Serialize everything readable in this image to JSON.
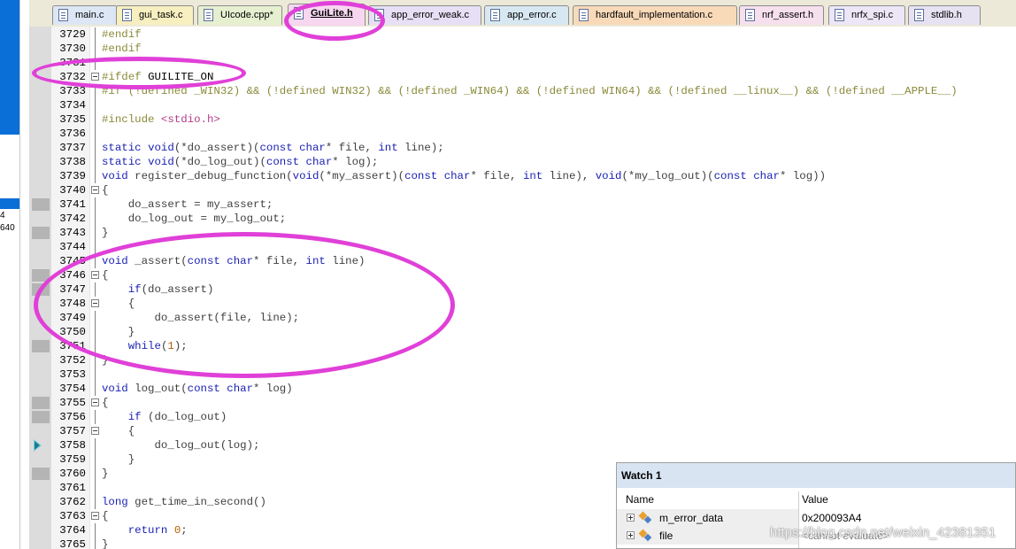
{
  "left_pane": {
    "fragments": [
      "4",
      "640"
    ]
  },
  "tabs": [
    {
      "label": "main.c",
      "active": false,
      "color": "#dce6f4"
    },
    {
      "label": "gui_task.c",
      "active": false,
      "color": "#f7efc0"
    },
    {
      "label": "UIcode.cpp*",
      "active": false,
      "color": "#e6efd0"
    },
    {
      "label": "GuiLite.h",
      "active": true,
      "color": "#f7d6f0"
    },
    {
      "label": "app_error_weak.c",
      "active": false,
      "color": "#e6dff5"
    },
    {
      "label": "app_error.c",
      "active": false,
      "color": "#d8e8f2"
    },
    {
      "label": "hardfault_implementation.c",
      "active": false,
      "color": "#f8d9b8"
    },
    {
      "label": "nrf_assert.h",
      "active": false,
      "color": "#f7e0ee"
    },
    {
      "label": "nrfx_spi.c",
      "active": false,
      "color": "#ece6f7"
    },
    {
      "label": "stdlib.h",
      "active": false,
      "color": "#e6e2f2"
    }
  ],
  "code_lines": [
    {
      "num": "3729",
      "text": "#endif",
      "kind": "preproc",
      "fold": "line"
    },
    {
      "num": "3730",
      "text": "#endif",
      "kind": "preproc",
      "fold": "line"
    },
    {
      "num": "3731",
      "text": "",
      "kind": "plain",
      "fold": "line"
    },
    {
      "num": "3732",
      "text": "#ifdef GUILITE_ON",
      "kind": "ifdef",
      "fold": "box"
    },
    {
      "num": "3733",
      "text": "#if (!defined _WIN32) && (!defined WIN32) && (!defined _WIN64) && (!defined WIN64) && (!defined __linux__) && (!defined __APPLE__)",
      "kind": "preproc",
      "fold": "line"
    },
    {
      "num": "3734",
      "text": "",
      "kind": "plain",
      "fold": "line"
    },
    {
      "num": "3735",
      "text": "#include <stdio.h>",
      "kind": "preproc",
      "fold": "line"
    },
    {
      "num": "3736",
      "text": "",
      "kind": "plain",
      "fold": "line"
    },
    {
      "num": "3737",
      "text": "static void(*do_assert)(const char* file, int line);",
      "kind": "code",
      "fold": "line"
    },
    {
      "num": "3738",
      "text": "static void(*do_log_out)(const char* log);",
      "kind": "code",
      "fold": "line"
    },
    {
      "num": "3739",
      "text": "void register_debug_function(void(*my_assert)(const char* file, int line), void(*my_log_out)(const char* log))",
      "kind": "code",
      "fold": "line"
    },
    {
      "num": "3740",
      "text": "{",
      "kind": "code",
      "fold": "box"
    },
    {
      "num": "3741",
      "text": "    do_assert = my_assert;",
      "kind": "code",
      "fold": "line",
      "bp": true
    },
    {
      "num": "3742",
      "text": "    do_log_out = my_log_out;",
      "kind": "code",
      "fold": "line"
    },
    {
      "num": "3743",
      "text": "}",
      "kind": "code",
      "fold": "line",
      "bp": true
    },
    {
      "num": "3744",
      "text": "",
      "kind": "plain",
      "fold": "line"
    },
    {
      "num": "3745",
      "text": "void _assert(const char* file, int line)",
      "kind": "code",
      "fold": "line"
    },
    {
      "num": "3746",
      "text": "{",
      "kind": "code",
      "fold": "box",
      "bp": true
    },
    {
      "num": "3747",
      "text": "    if(do_assert)",
      "kind": "code",
      "fold": "line",
      "bp": true
    },
    {
      "num": "3748",
      "text": "    {",
      "kind": "code",
      "fold": "box"
    },
    {
      "num": "3749",
      "text": "        do_assert(file, line);",
      "kind": "code",
      "fold": "line"
    },
    {
      "num": "3750",
      "text": "    }",
      "kind": "code",
      "fold": "line"
    },
    {
      "num": "3751",
      "text": "    while(1);",
      "kind": "code",
      "fold": "line",
      "bp": true
    },
    {
      "num": "3752",
      "text": "}",
      "kind": "code",
      "fold": "line"
    },
    {
      "num": "3753",
      "text": "",
      "kind": "plain",
      "fold": "line"
    },
    {
      "num": "3754",
      "text": "void log_out(const char* log)",
      "kind": "code",
      "fold": "line"
    },
    {
      "num": "3755",
      "text": "{",
      "kind": "code",
      "fold": "box",
      "bp": true
    },
    {
      "num": "3756",
      "text": "    if (do_log_out)",
      "kind": "code",
      "fold": "line",
      "bp": true
    },
    {
      "num": "3757",
      "text": "    {",
      "kind": "code",
      "fold": "box"
    },
    {
      "num": "3758",
      "text": "        do_log_out(log);",
      "kind": "code",
      "fold": "line",
      "arrow": true
    },
    {
      "num": "3759",
      "text": "    }",
      "kind": "code",
      "fold": "line"
    },
    {
      "num": "3760",
      "text": "}",
      "kind": "code",
      "fold": "line",
      "bp": true
    },
    {
      "num": "3761",
      "text": "",
      "kind": "plain",
      "fold": "line"
    },
    {
      "num": "3762",
      "text": "long get_time_in_second()",
      "kind": "code",
      "fold": "line"
    },
    {
      "num": "3763",
      "text": "{",
      "kind": "code",
      "fold": "box"
    },
    {
      "num": "3764",
      "text": "    return 0;",
      "kind": "code",
      "fold": "line"
    },
    {
      "num": "3765",
      "text": "}",
      "kind": "code",
      "fold": "line"
    }
  ],
  "watch": {
    "title": "Watch 1",
    "col_name": "Name",
    "col_value": "Value",
    "rows": [
      {
        "name": "m_error_data",
        "value": "0x200093A4",
        "greyed": false
      },
      {
        "name": "file",
        "value": "<cannot evaluate>",
        "greyed": true
      }
    ]
  },
  "watermark": "https://blog.csdn.net/weixin_42381351",
  "colors": {
    "keyword": "#1c22b4",
    "preproc": "#8a8a3a",
    "string_include": "#b43c8a",
    "number": "#b85c00",
    "annotation": "#e040d8"
  }
}
